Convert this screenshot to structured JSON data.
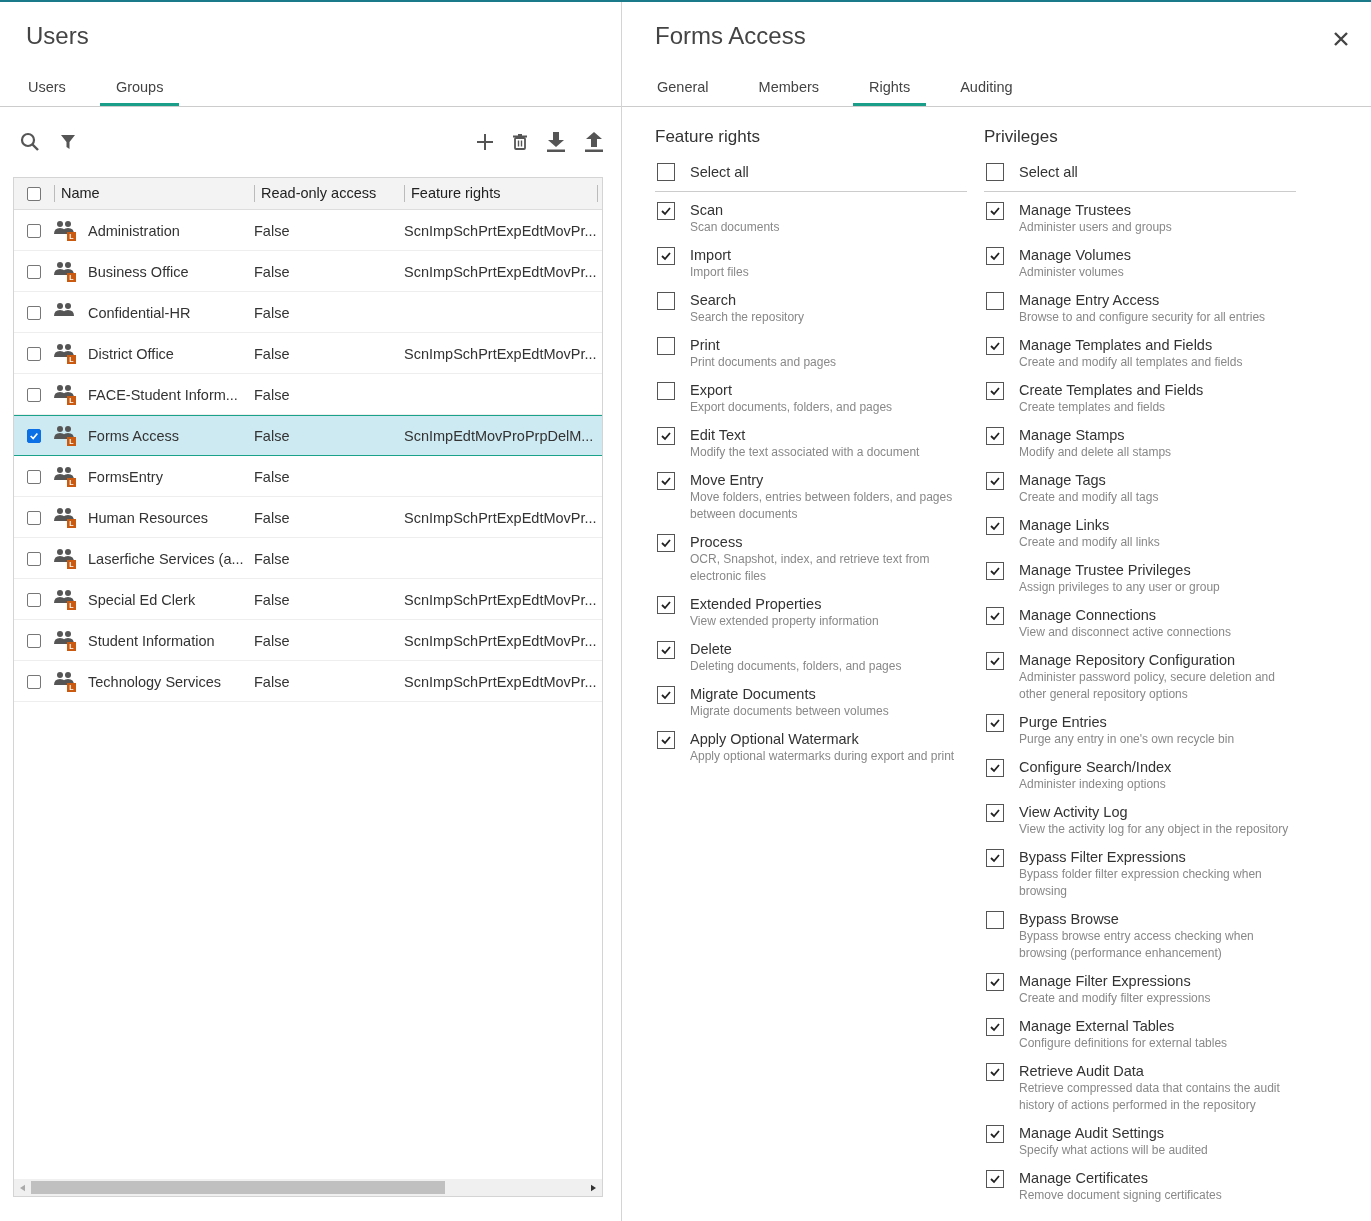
{
  "left_panel": {
    "title": "Users",
    "tabs": [
      {
        "label": "Users",
        "selected": false
      },
      {
        "label": "Groups",
        "selected": true
      }
    ],
    "table": {
      "select_all_checked": false,
      "columns": [
        "Name",
        "Read-only access",
        "Feature rights"
      ],
      "rows": [
        {
          "checked": false,
          "selected": false,
          "badge": "L",
          "name": "Administration",
          "read_only": "False",
          "feature_rights": "ScnImpSchPrtExpEdtMovPr..."
        },
        {
          "checked": false,
          "selected": false,
          "badge": "L",
          "name": "Business Office",
          "read_only": "False",
          "feature_rights": "ScnImpSchPrtExpEdtMovPr..."
        },
        {
          "checked": false,
          "selected": false,
          "name": "Confidential-HR",
          "read_only": "False"
        },
        {
          "checked": false,
          "selected": false,
          "badge": "L",
          "name": "District Office",
          "read_only": "False",
          "feature_rights": "ScnImpSchPrtExpEdtMovPr..."
        },
        {
          "checked": false,
          "selected": false,
          "badge": "L",
          "name": "FACE-Student Inform...",
          "read_only": "False"
        },
        {
          "checked": true,
          "selected": true,
          "badge": "L",
          "name": "Forms Access",
          "read_only": "False",
          "feature_rights": "ScnImpEdtMovProPrpDelM..."
        },
        {
          "checked": false,
          "selected": false,
          "badge": "L",
          "name": "FormsEntry",
          "read_only": "False"
        },
        {
          "checked": false,
          "selected": false,
          "badge": "L",
          "name": "Human Resources",
          "read_only": "False",
          "feature_rights": "ScnImpSchPrtExpEdtMovPr..."
        },
        {
          "checked": false,
          "selected": false,
          "badge": "L",
          "name": "Laserfiche Services (a...",
          "read_only": "False"
        },
        {
          "checked": false,
          "selected": false,
          "badge": "L",
          "name": "Special Ed Clerk",
          "read_only": "False",
          "feature_rights": "ScnImpSchPrtExpEdtMovPr..."
        },
        {
          "checked": false,
          "selected": false,
          "badge": "L",
          "name": "Student Information",
          "read_only": "False",
          "feature_rights": "ScnImpSchPrtExpEdtMovPr..."
        },
        {
          "checked": false,
          "selected": false,
          "badge": "L",
          "name": "Technology Services",
          "read_only": "False",
          "feature_rights": "ScnImpSchPrtExpEdtMovPr..."
        }
      ]
    }
  },
  "right_panel": {
    "title": "Forms Access",
    "tabs": [
      {
        "label": "General",
        "selected": false
      },
      {
        "label": "Members",
        "selected": false
      },
      {
        "label": "Rights",
        "selected": true
      },
      {
        "label": "Auditing",
        "selected": false
      }
    ],
    "sections": [
      {
        "heading": "Feature rights",
        "select_all": {
          "label": "Select all",
          "checked": false
        },
        "items": [
          {
            "label": "Scan",
            "description": "Scan documents",
            "checked": true
          },
          {
            "label": "Import",
            "description": "Import files",
            "checked": true
          },
          {
            "label": "Search",
            "description": "Search the repository",
            "checked": false
          },
          {
            "label": "Print",
            "description": "Print documents and pages",
            "checked": false
          },
          {
            "label": "Export",
            "description": "Export documents, folders, and pages",
            "checked": false
          },
          {
            "label": "Edit Text",
            "description": "Modify the text associated with a document",
            "checked": true
          },
          {
            "label": "Move Entry",
            "description": "Move folders, entries between folders, and pages between documents",
            "checked": true
          },
          {
            "label": "Process",
            "description": "OCR, Snapshot, index, and retrieve text from electronic files",
            "checked": true
          },
          {
            "label": "Extended Properties",
            "description": "View extended property information",
            "checked": true
          },
          {
            "label": "Delete",
            "description": "Deleting documents, folders, and pages",
            "checked": true
          },
          {
            "label": "Migrate Documents",
            "description": "Migrate documents between volumes",
            "checked": true
          },
          {
            "label": "Apply Optional Watermark",
            "description": "Apply optional watermarks during export and print",
            "checked": true
          }
        ]
      },
      {
        "heading": "Privileges",
        "select_all": {
          "label": "Select all",
          "checked": false
        },
        "items": [
          {
            "label": "Manage Trustees",
            "description": "Administer users and groups",
            "checked": true
          },
          {
            "label": "Manage Volumes",
            "description": "Administer volumes",
            "checked": true
          },
          {
            "label": "Manage Entry Access",
            "description": "Browse to and configure security for all entries",
            "checked": false
          },
          {
            "label": "Manage Templates and Fields",
            "description": "Create and modify all templates and fields",
            "checked": true
          },
          {
            "label": "Create Templates and Fields",
            "description": "Create templates and fields",
            "checked": true
          },
          {
            "label": "Manage Stamps",
            "description": "Modify and delete all stamps",
            "checked": true
          },
          {
            "label": "Manage Tags",
            "description": "Create and modify all tags",
            "checked": true
          },
          {
            "label": "Manage Links",
            "description": "Create and modify all links",
            "checked": true
          },
          {
            "label": "Manage Trustee Privileges",
            "description": "Assign privileges to any user or group",
            "checked": true
          },
          {
            "label": "Manage Connections",
            "description": "View and disconnect active connections",
            "checked": true
          },
          {
            "label": "Manage Repository Configuration",
            "description": "Administer password policy, secure deletion and other general repository options",
            "checked": true
          },
          {
            "label": "Purge Entries",
            "description": "Purge any entry in one's own recycle bin",
            "checked": true
          },
          {
            "label": "Configure Search/Index",
            "description": "Administer indexing options",
            "checked": true
          },
          {
            "label": "View Activity Log",
            "description": "View the activity log for any object in the repository",
            "checked": true
          },
          {
            "label": "Bypass Filter Expressions",
            "description": "Bypass folder filter expression checking when browsing",
            "checked": true
          },
          {
            "label": "Bypass Browse",
            "description": "Bypass browse entry access checking when browsing (performance enhancement)",
            "checked": false
          },
          {
            "label": "Manage Filter Expressions",
            "description": "Create and modify filter expressions",
            "checked": true
          },
          {
            "label": "Manage External Tables",
            "description": "Configure definitions for external tables",
            "checked": true
          },
          {
            "label": "Retrieve Audit Data",
            "description": "Retrieve compressed data that contains the audit history of actions performed in the repository",
            "checked": true
          },
          {
            "label": "Manage Audit Settings",
            "description": "Specify what actions will be audited",
            "checked": true
          },
          {
            "label": "Manage Certificates",
            "description": "Remove document signing certificates",
            "checked": true
          }
        ]
      }
    ]
  }
}
